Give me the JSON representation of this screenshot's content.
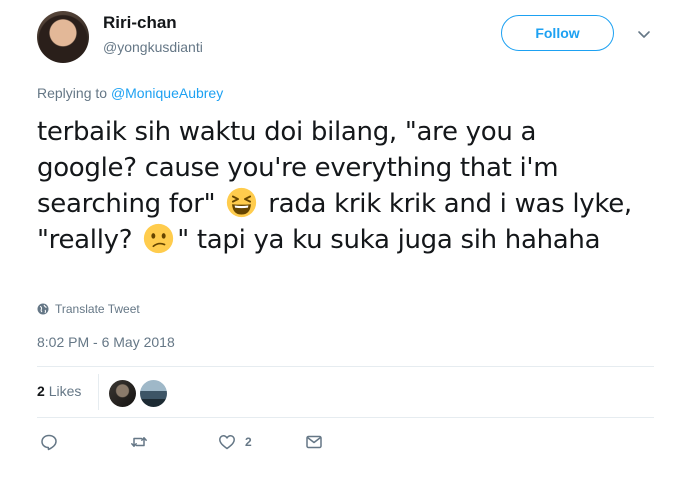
{
  "user": {
    "display_name": "Riri-chan",
    "handle": "@yongkusdianti",
    "avatar": "profile-photo"
  },
  "follow_label": "Follow",
  "reply": {
    "prefix": "Replying to ",
    "mention": "@MoniqueAubrey"
  },
  "tweet": {
    "text_part1": "terbaik sih waktu doi bilang, \"are you a google? cause you're everything that i'm searching for\"",
    "emoji1": "laughing-squinting-face",
    "text_part2": " rada krik krik and i was lyke, \"really? ",
    "emoji2": "confused-face",
    "text_part3": "\" tapi ya ku suka juga sih hahaha"
  },
  "translate_label": "Translate Tweet",
  "timestamp": "8:02 PM - 6 May 2018",
  "likes": {
    "count": "2",
    "label": "Likes"
  },
  "actions": {
    "reply_count": "",
    "retweet_count": "",
    "like_count": "2"
  },
  "colors": {
    "accent": "#1da1f2",
    "muted": "#657786",
    "text": "#14171a",
    "divider": "#e6ecf0"
  }
}
